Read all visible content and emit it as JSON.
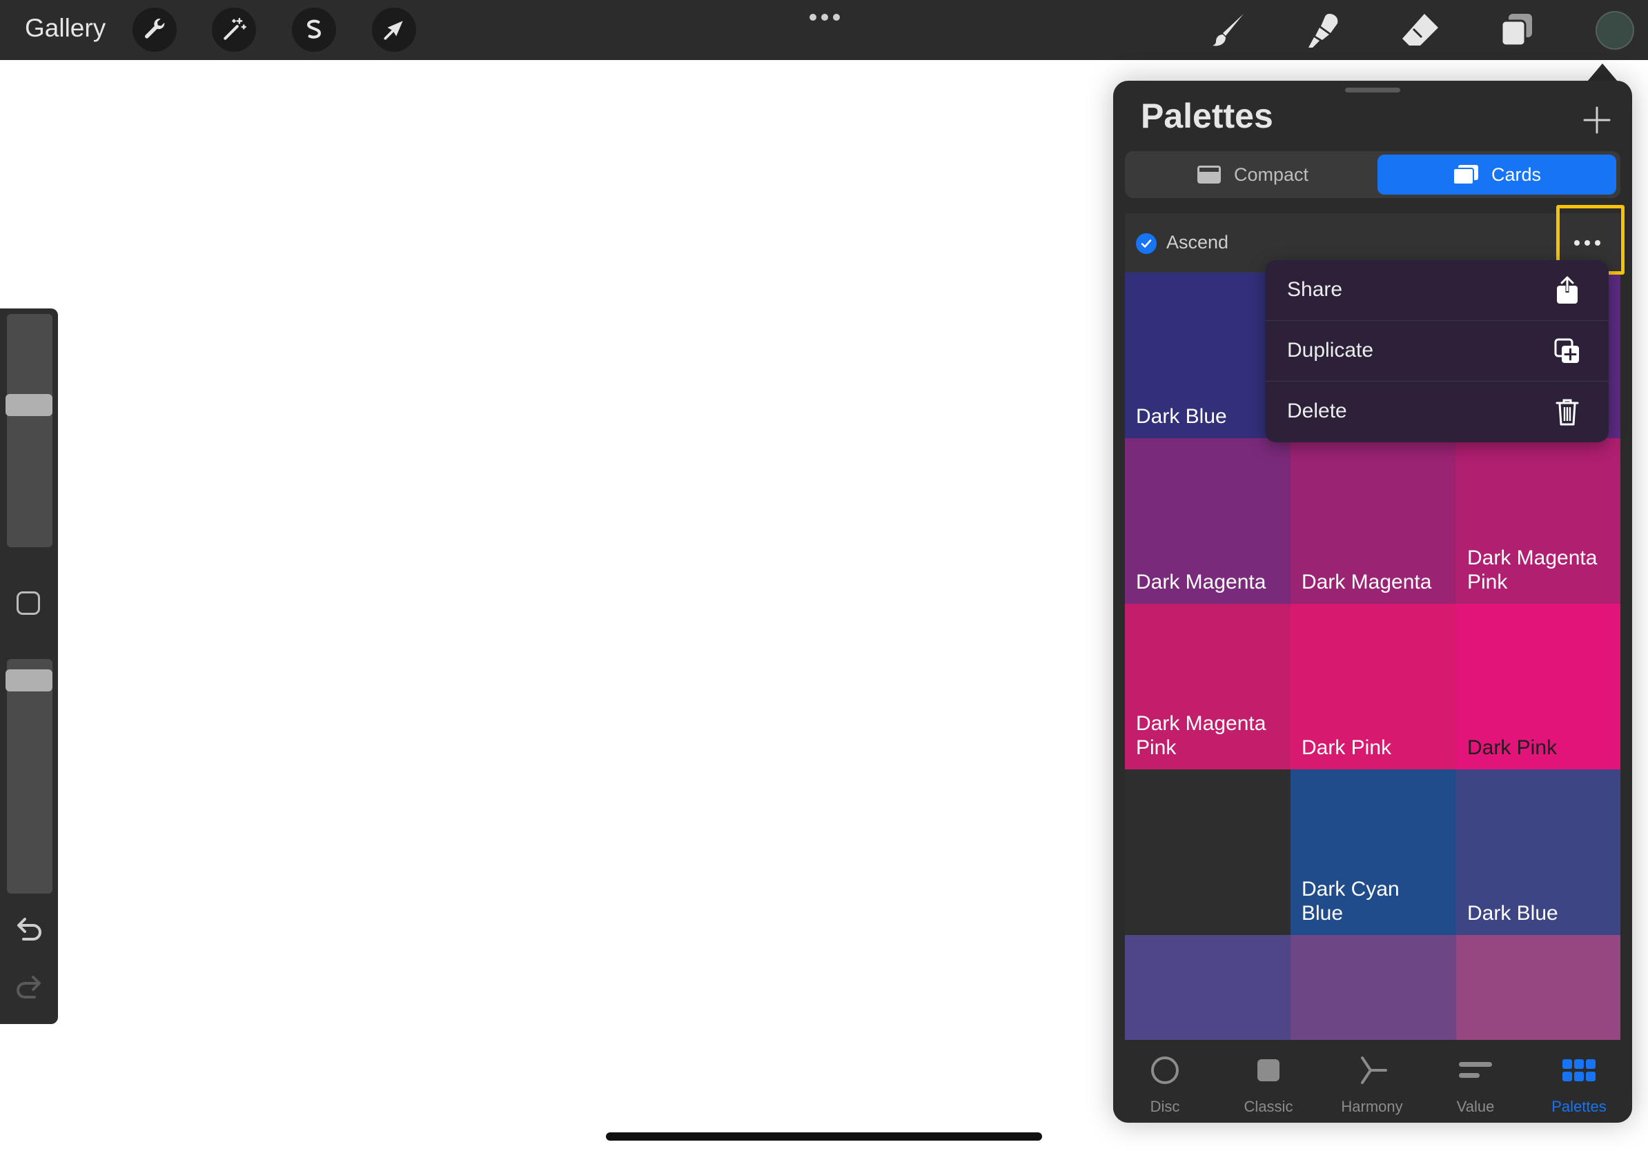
{
  "topbar": {
    "gallery_label": "Gallery",
    "tools_left": [
      "wrench-icon",
      "magic-wand-icon",
      "selection-icon",
      "transform-arrow-icon"
    ],
    "tools_right": [
      "brush-icon",
      "smudge-icon",
      "eraser-icon",
      "layers-icon"
    ],
    "current_color": "#3a4b46"
  },
  "sidebar": {
    "brush_size_level": 0.38,
    "opacity_level": 0.05
  },
  "panel": {
    "title": "Palettes",
    "segments": {
      "compact_label": "Compact",
      "cards_label": "Cards",
      "selected": "Cards"
    },
    "palette": {
      "name": "Ascend",
      "is_default": true
    },
    "menu": {
      "share_label": "Share",
      "duplicate_label": "Duplicate",
      "delete_label": "Delete"
    },
    "swatches": [
      {
        "label": "Dark Blue",
        "color": "#32307a",
        "text_color": "#ffffff"
      },
      {
        "label": "",
        "color": "#4a2b7e",
        "text_color": "#ffffff"
      },
      {
        "label": "",
        "color": "#5d2a83",
        "text_color": "#ffffff"
      },
      {
        "label": "Dark Magenta",
        "color": "#7a2a7a",
        "text_color": "#ffffff"
      },
      {
        "label": "Dark Magenta",
        "color": "#9b2374",
        "text_color": "#ffffff"
      },
      {
        "label": "Dark Magenta\nPink",
        "color": "#b01f70",
        "text_color": "#ffffff"
      },
      {
        "label": "Dark Magenta\nPink",
        "color": "#c31e6c",
        "text_color": "#ffffff"
      },
      {
        "label": "Dark Pink",
        "color": "#d71a70",
        "text_color": "#ffffff"
      },
      {
        "label": "Dark Pink",
        "color": "#e2147a",
        "text_color": "#1e1e1e"
      },
      {
        "label": "",
        "color": "#2e2e2e",
        "text_color": "#ffffff"
      },
      {
        "label": "Dark Cyan\nBlue",
        "color": "#204c8c",
        "text_color": "#ffffff"
      },
      {
        "label": "Dark Blue",
        "color": "#3d4585",
        "text_color": "#ffffff"
      },
      {
        "label": "",
        "color": "#4f4687",
        "text_color": "#ffffff"
      },
      {
        "label": "",
        "color": "#6c4685",
        "text_color": "#ffffff"
      },
      {
        "label": "",
        "color": "#964680",
        "text_color": "#ffffff"
      }
    ],
    "tabs": [
      {
        "label": "Disc",
        "icon": "disc-icon"
      },
      {
        "label": "Classic",
        "icon": "classic-icon"
      },
      {
        "label": "Harmony",
        "icon": "harmony-icon"
      },
      {
        "label": "Value",
        "icon": "value-icon"
      },
      {
        "label": "Palettes",
        "icon": "palettes-icon",
        "active": true
      }
    ]
  }
}
